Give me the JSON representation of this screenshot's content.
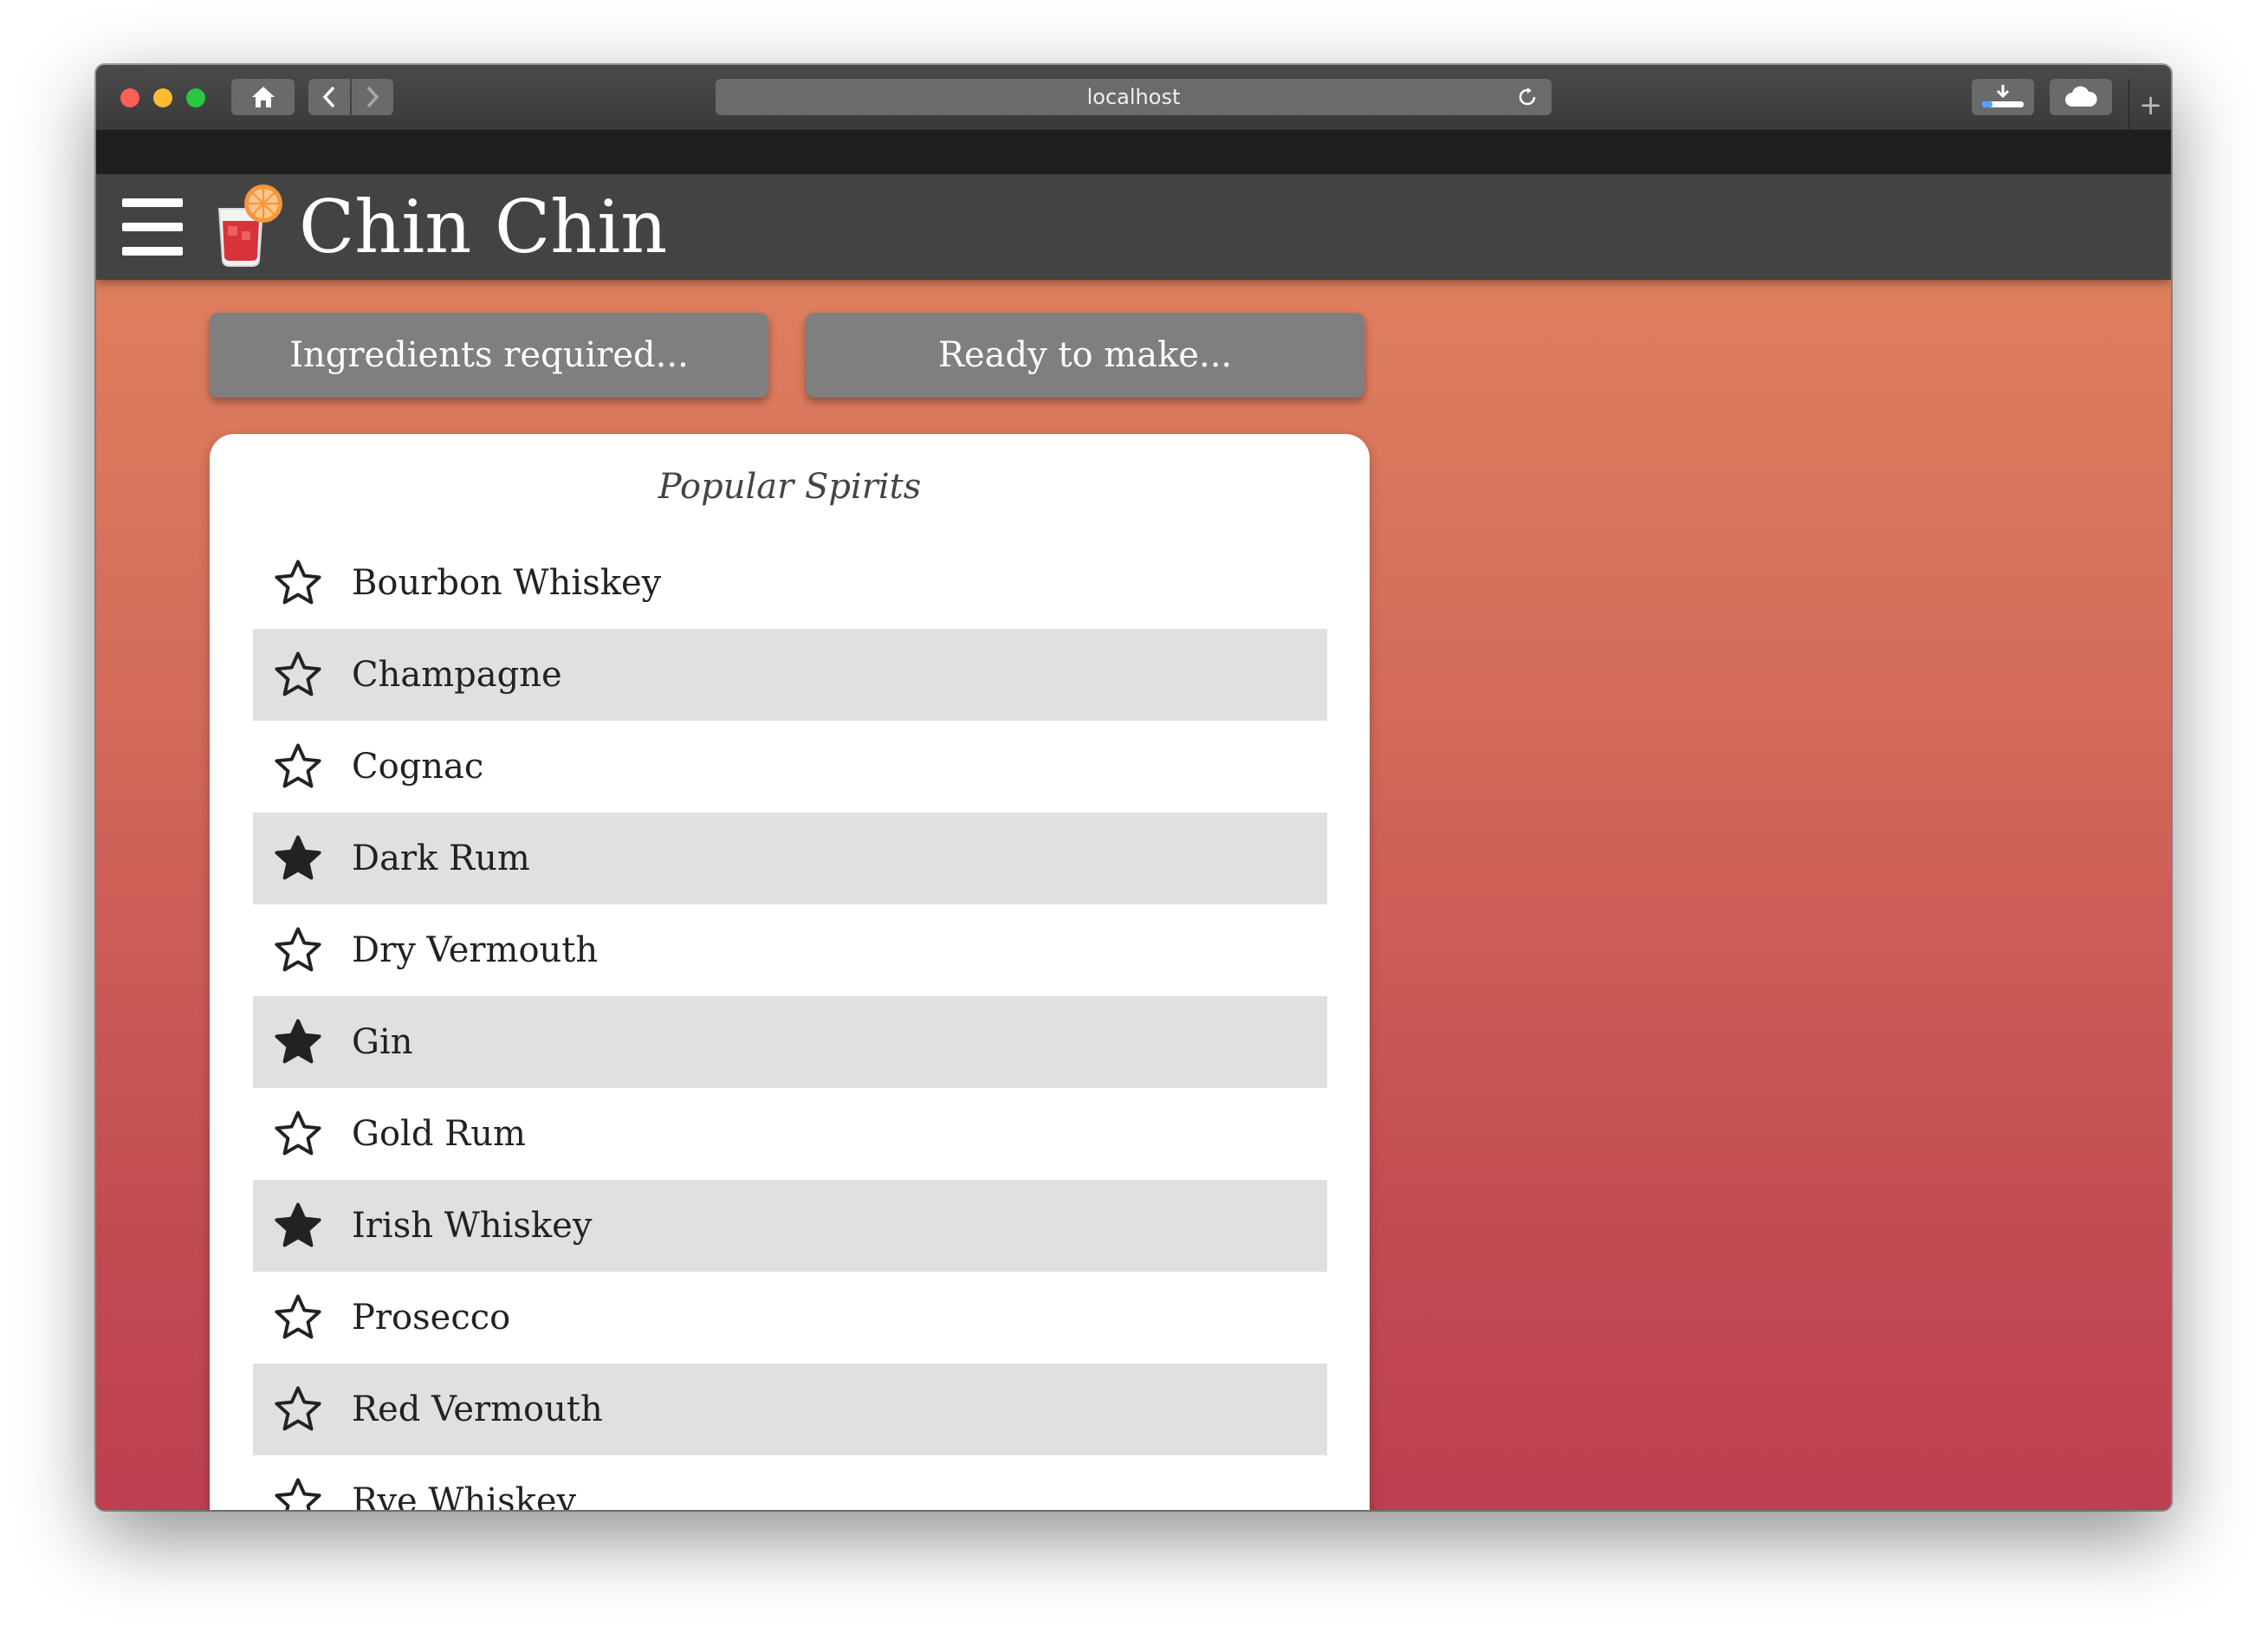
{
  "browser": {
    "address": "localhost"
  },
  "app": {
    "title": "Chin Chin"
  },
  "actions": {
    "ingredients_label": "Ingredients required...",
    "ready_label": "Ready to make..."
  },
  "card": {
    "title": "Popular Spirits",
    "items": [
      {
        "label": "Bourbon Whiskey",
        "starred": false
      },
      {
        "label": "Champagne",
        "starred": false
      },
      {
        "label": "Cognac",
        "starred": false
      },
      {
        "label": "Dark Rum",
        "starred": true
      },
      {
        "label": "Dry Vermouth",
        "starred": false
      },
      {
        "label": "Gin",
        "starred": true
      },
      {
        "label": "Gold Rum",
        "starred": false
      },
      {
        "label": "Irish Whiskey",
        "starred": true
      },
      {
        "label": "Prosecco",
        "starred": false
      },
      {
        "label": "Red Vermouth",
        "starred": false
      },
      {
        "label": "Rye Whiskey",
        "starred": false
      }
    ]
  },
  "colors": {
    "appbar": "#434343",
    "button": "#7f7f7f",
    "row_shade": "#e0e0e0",
    "gradient_top": "#e1845f",
    "gradient_bottom": "#bd3f50"
  }
}
